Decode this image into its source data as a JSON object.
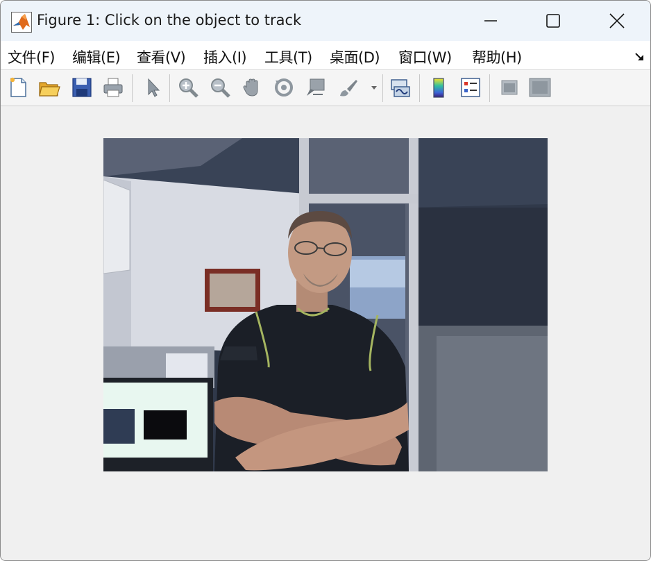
{
  "window": {
    "title": "Figure 1: Click on the object to track"
  },
  "menubar": {
    "items": [
      {
        "label": "文件(F)"
      },
      {
        "label": "编辑(E)"
      },
      {
        "label": "查看(V)"
      },
      {
        "label": "插入(I)"
      },
      {
        "label": "工具(T)"
      },
      {
        "label": "桌面(D)"
      },
      {
        "label": "窗口(W)"
      },
      {
        "label": "帮助(H)"
      }
    ]
  },
  "toolbar": {
    "buttons": [
      {
        "icon": "new-figure-icon"
      },
      {
        "icon": "open-folder-icon"
      },
      {
        "icon": "save-disk-icon"
      },
      {
        "icon": "print-icon"
      },
      {
        "icon": "pointer-arrow-icon"
      },
      {
        "icon": "zoom-in-icon"
      },
      {
        "icon": "zoom-out-icon"
      },
      {
        "icon": "pan-hand-icon"
      },
      {
        "icon": "rotate-3d-icon"
      },
      {
        "icon": "data-cursor-icon"
      },
      {
        "icon": "brush-icon"
      },
      {
        "icon": "link-plot-icon"
      },
      {
        "icon": "colorbar-icon"
      },
      {
        "icon": "legend-icon"
      },
      {
        "icon": "hide-plot-tools-icon"
      },
      {
        "icon": "show-plot-tools-icon"
      }
    ]
  },
  "figure": {
    "image_subject": "webcam-frame"
  },
  "colors": {
    "titlebar": "#eef4fa",
    "figure_background": "#f0f0f0",
    "matlab_orange": "#e06a1b"
  }
}
